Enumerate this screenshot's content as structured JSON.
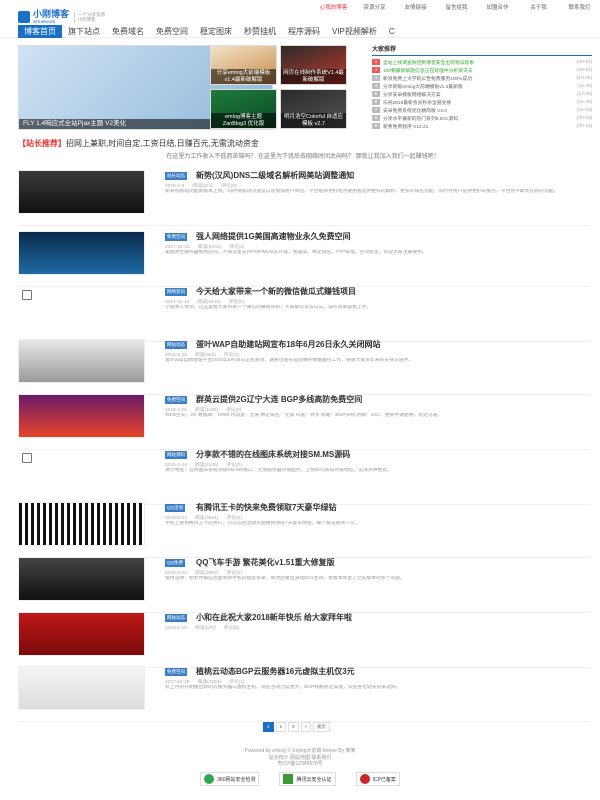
{
  "site": {
    "logo_cn": "小刚博客",
    "logo_en": "XHnetwork",
    "logo_sub1": "一个分享资源",
    "logo_sub2": "IT的博客"
  },
  "toplinks": [
    "心我的博客",
    "资源分享",
    "友情链接",
    "留言给我",
    "加盟合作",
    "关于我",
    "联系我们"
  ],
  "nav": [
    "博客首页",
    "旗下站点",
    "免费域名",
    "免费空间",
    "稳定图床",
    "秒赞挂机",
    "程序源码",
    "VIP视频解析",
    "C"
  ],
  "slider": {
    "caption": "FLY 1.4响应式全站Pjax主题 V2美化"
  },
  "thumbs": [
    {
      "caption": "分享emlog大前端模板v1.4最新破解版"
    },
    {
      "caption": "网页在线制作系统V1.4最新破解版"
    },
    {
      "caption": "emlog博客主题 ZanBlog3 优化版"
    },
    {
      "caption": "明月浩空Colorful 自适应模板 v2.7"
    }
  ],
  "rank": {
    "title": "大家推荐",
    "items": [
      {
        "n": "1",
        "t": "全站上线调查防控制博客安全出现错误现象",
        "d": "[08-04]",
        "hot": true
      },
      {
        "n": "2",
        "t": "100要最新解题信息正在处理中分析资讯去",
        "d": "[08-04]",
        "hot": true
      },
      {
        "n": "3",
        "t": "新浪免费上大学的公告免费服务100%成功",
        "d": "[10-05]",
        "hot": false
      },
      {
        "n": "4",
        "t": "分享新版emlog大前端模板v1.4最新版",
        "d": "[11-25]",
        "hot": false
      },
      {
        "n": "5",
        "t": "分享安卓模板网络解决方案",
        "d": "[12-06]",
        "hot": false
      },
      {
        "n": "6",
        "t": "乐视2015最新会员秒杀全部兑换",
        "d": "[01-25]",
        "hot": false
      },
      {
        "n": "7",
        "t": "安卓免费系统优化精简版 V3.0",
        "d": "[01-03]",
        "hot": false
      },
      {
        "n": "8",
        "t": "分享水平最新的热门系列5.M.C源码",
        "d": "[02-24]",
        "hot": false
      },
      {
        "n": "9",
        "t": "新秀免费程序 V12.21",
        "d": "[02-13]",
        "hot": false
      }
    ]
  },
  "notice": {
    "tag": "【站长推荐】",
    "line1": "招网上兼职,时间自定,工资日结,日赚百元,无需流动资金",
    "line2": "在这里为工作收入不低而苦恼吗？ 在这里为下班后去网络时间太闲吗？ 那就让我加入我们一起赚钱吧！"
  },
  "posts": [
    {
      "cat": "站长动态",
      "title": "新势(汉风)DNS二级域名解析网美站调整通知",
      "date": "2018-4-9",
      "views": "阅读(321)",
      "comments": "评论(0)",
      "excerpt": "新系统新站功能新版本上线，同时增加访问速度以及增加用户体验，平台能够更好地为使用者提供更好的解析、更多的域名功能，同时为用户提供更好的服务，平台会不断优化新的功能。"
    },
    {
      "cat": "免费空间",
      "title": "强人网络提供1G美国高速物业永久免费空间",
      "date": "2017-12-23",
      "views": "阅读(6434)",
      "comments": "评论(2)",
      "excerpt": "美国原生服务器免费空间，不限流量支持PHP/MySQL环境，免备案，绑定域名，FTP管理，空间稳定，欢迎大家注册使用。"
    },
    {
      "cat": "网络资讯",
      "title": "今天给大家带来一个新的微信做瓜式赚钱项目",
      "date": "2017-11-14",
      "views": "阅读(9416)",
      "comments": "评论(0)",
      "excerpt": "小站本人亲测，在这里给大家带来一个微信的赚钱项目，大家都可以去试试，操作简单容易上手。"
    },
    {
      "cat": "网站动态",
      "title": "蛋叶WAP自助建站网宣布18年6月26日永久关闭网站",
      "date": "2018-5-28",
      "views": "阅读(954)",
      "comments": "评论(0)",
      "excerpt": "蛋叶wap自助建站平台2018年6月26日正式关闭，请各位站长提前做好数据备份工作，感谢大家多年来的支持与陪伴。"
    },
    {
      "cat": "免费空间",
      "title": "群英云提供2G辽宁大连 BGP多线高防免费空间",
      "date": "2018-4-25",
      "views": "阅读(1180)",
      "comments": "评论(0)",
      "excerpt": "WEB空间：2G 数据库：100M 月流量：无限 绑定域名：无限 带宽：共享 线路：BGP多线 防御：10G，免费申请使用，稳定可靠。"
    },
    {
      "cat": "网站源码",
      "title": "分享款不错的在线图床系统对接SM.MS源码",
      "date": "2018-2-24",
      "views": "阅读(4145)",
      "comments": "评论(0)",
      "excerpt": "演示地址：在线图床系统对接SM.MS接口，无需服务器存储图片，上传即可获得外链地址，支持多种格式。"
    },
    {
      "cat": "QQ活动",
      "title": "有腾讯王卡的快来免费领取7天豪华绿钻",
      "date": "2018-2-24",
      "views": "阅读(5941)",
      "comments": "评论(0)",
      "excerpt": "手机上使用腾讯王卡的用户，可以前往活动页面免费领取7天豪华绿钻，每个账号限领一次。"
    },
    {
      "cat": "QQ免费",
      "title": "QQ飞车手游 繁花美化v1.51重大修复版",
      "date": "2018-2-24",
      "views": "阅读(2557)",
      "comments": "评论(0)",
      "excerpt": "使用说明：把文件解压后复制到手机的指定目录，修改后重启游戏即可生效，本版本修复了之前版本的多个问题。"
    },
    {
      "cat": "网站动态",
      "title": "小和在此祝大家2018新年快乐 给大家拜年啦",
      "date": "2018-2-16",
      "views": "阅读(670)",
      "comments": "评论(0)",
      "excerpt": ""
    },
    {
      "cat": "免费空间",
      "title": "植桃云动态BGP云服务器16元虚拟主机仅3元",
      "date": "2017-12-28",
      "views": "阅读(2254)",
      "comments": "评论(1)",
      "excerpt": "从上月份开始推出新的云服务器与虚拟主机，现在活动力度更大，BGP线路稳定高速，欢迎各位站长前来选购。"
    }
  ],
  "pager": [
    "1",
    "2",
    "3",
    "»",
    "尾页"
  ],
  "footer": {
    "line1": "Powered by emlog © Emlog大前端 theme By 某某",
    "line2": "站长统计 网站地图 联系我们",
    "line3": "粤ICP备12345678号"
  },
  "badges": [
    "360网站安全检测",
    "腾讯云安全认证",
    "ICP已备案"
  ]
}
